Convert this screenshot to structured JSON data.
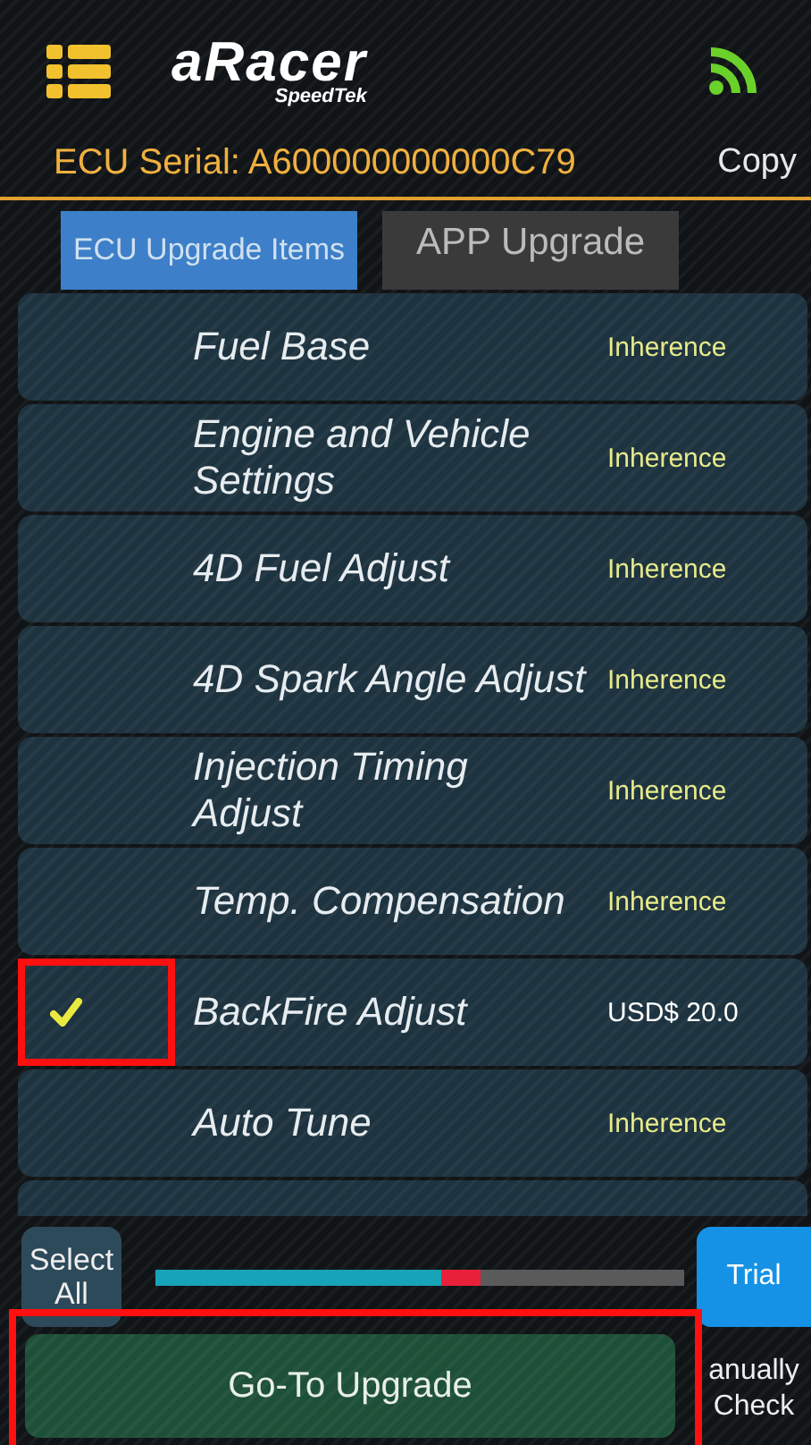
{
  "header": {
    "brand": "aRacer",
    "brand_sub": "SpeedTek",
    "serial": "ECU Serial: A600000000000C79",
    "copy_button": "Copy"
  },
  "tabs": [
    {
      "label": "ECU Upgrade Items",
      "selected": true
    },
    {
      "label": "APP Upgrade",
      "selected": false
    }
  ],
  "items": [
    {
      "name": "Fuel Base",
      "price": "Inherence",
      "kind": "inherent",
      "checked": false,
      "highlighted": false
    },
    {
      "name": "Engine and Vehicle\nSettings",
      "price": "Inherence",
      "kind": "inherent",
      "checked": false,
      "highlighted": false
    },
    {
      "name": "4D Fuel Adjust",
      "price": "Inherence",
      "kind": "inherent",
      "checked": false,
      "highlighted": false
    },
    {
      "name": "4D Spark Angle Adjust",
      "price": "Inherence",
      "kind": "inherent",
      "checked": false,
      "highlighted": false
    },
    {
      "name": "Injection Timing\nAdjust",
      "price": "Inherence",
      "kind": "inherent",
      "checked": false,
      "highlighted": false
    },
    {
      "name": "Temp. Compensation",
      "price": "Inherence",
      "kind": "inherent",
      "checked": false,
      "highlighted": false
    },
    {
      "name": "BackFire Adjust",
      "price": "USD$ 20.0",
      "kind": "paid",
      "checked": true,
      "highlighted": true
    },
    {
      "name": "Auto Tune",
      "price": "Inherence",
      "kind": "inherent",
      "checked": false,
      "highlighted": false
    }
  ],
  "footer": {
    "select_all": "Select All",
    "progress": {
      "level": 0.54
    },
    "trial_button": "Trial",
    "upgrade_button": "Go-To Upgrade",
    "upgrade_highlighted": true,
    "manual_check": "anually Check"
  }
}
